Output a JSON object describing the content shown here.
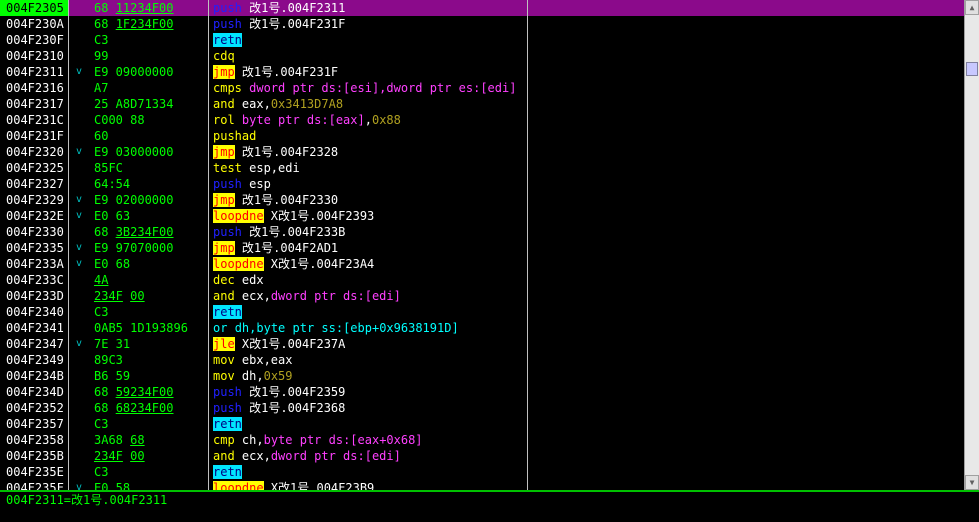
{
  "rows": [
    {
      "addr": "004F2305",
      "arrow": "",
      "hex": [
        {
          "t": "68 ",
          "u": false
        },
        {
          "t": "11234F00",
          "u": true
        }
      ],
      "dis": [
        {
          "t": "push",
          "c": "m-push"
        },
        {
          "t": " 改1号.004F2311",
          "c": "t-white"
        }
      ],
      "sel": true
    },
    {
      "addr": "004F230A",
      "arrow": "",
      "hex": [
        {
          "t": "68 ",
          "u": false
        },
        {
          "t": "1F234F00",
          "u": true
        }
      ],
      "dis": [
        {
          "t": "push",
          "c": "m-push"
        },
        {
          "t": " 改1号.004F231F",
          "c": "t-white"
        }
      ]
    },
    {
      "addr": "004F230F",
      "arrow": "",
      "hex": [
        {
          "t": "C3",
          "u": false
        }
      ],
      "dis": [
        {
          "t": "retn",
          "c": "m-retn"
        }
      ]
    },
    {
      "addr": "004F2310",
      "arrow": "",
      "hex": [
        {
          "t": "99",
          "u": false
        }
      ],
      "dis": [
        {
          "t": "cdq",
          "c": "m-yellow"
        }
      ]
    },
    {
      "addr": "004F2311",
      "arrow": "v",
      "hex": [
        {
          "t": "E9 09000000",
          "u": false
        }
      ],
      "dis": [
        {
          "t": "jmp",
          "c": "m-jmp"
        },
        {
          "t": " 改1号.004F231F",
          "c": "t-white"
        }
      ]
    },
    {
      "addr": "004F2316",
      "arrow": "",
      "hex": [
        {
          "t": "A7",
          "u": false
        }
      ],
      "dis": [
        {
          "t": "cmps ",
          "c": "m-yellow"
        },
        {
          "t": "dword ptr ds:[esi],dword ptr es:[edi]",
          "c": "t-purple"
        }
      ]
    },
    {
      "addr": "004F2317",
      "arrow": "",
      "hex": [
        {
          "t": "25 A8D71334",
          "u": false
        }
      ],
      "dis": [
        {
          "t": "and ",
          "c": "m-yellow"
        },
        {
          "t": "eax,",
          "c": "t-white"
        },
        {
          "t": "0x3413D7A8",
          "c": "t-olive"
        }
      ]
    },
    {
      "addr": "004F231C",
      "arrow": "",
      "hex": [
        {
          "t": "C000 88",
          "u": false
        }
      ],
      "dis": [
        {
          "t": "rol ",
          "c": "m-yellow"
        },
        {
          "t": "byte ptr ds:[eax]",
          "c": "t-purple"
        },
        {
          "t": ",",
          "c": "t-white"
        },
        {
          "t": "0x88",
          "c": "t-olive"
        }
      ]
    },
    {
      "addr": "004F231F",
      "arrow": "",
      "hex": [
        {
          "t": "60",
          "u": false
        }
      ],
      "dis": [
        {
          "t": "pushad",
          "c": "m-yellow"
        }
      ]
    },
    {
      "addr": "004F2320",
      "arrow": "v",
      "hex": [
        {
          "t": "E9 03000000",
          "u": false
        }
      ],
      "dis": [
        {
          "t": "jmp",
          "c": "m-jmp"
        },
        {
          "t": " 改1号.004F2328",
          "c": "t-white"
        }
      ]
    },
    {
      "addr": "004F2325",
      "arrow": "",
      "hex": [
        {
          "t": "85FC",
          "u": false
        }
      ],
      "dis": [
        {
          "t": "test ",
          "c": "m-yellow"
        },
        {
          "t": "esp,edi",
          "c": "t-white"
        }
      ]
    },
    {
      "addr": "004F2327",
      "arrow": "",
      "hex": [
        {
          "t": "64:54",
          "u": false
        }
      ],
      "dis": [
        {
          "t": "push",
          "c": "m-push"
        },
        {
          "t": " esp",
          "c": "t-white"
        }
      ]
    },
    {
      "addr": "004F2329",
      "arrow": "v",
      "hex": [
        {
          "t": "E9 02000000",
          "u": false
        }
      ],
      "dis": [
        {
          "t": "jmp",
          "c": "m-jmp"
        },
        {
          "t": " 改1号.004F2330",
          "c": "t-white"
        }
      ]
    },
    {
      "addr": "004F232E",
      "arrow": "v",
      "hex": [
        {
          "t": "E0 63",
          "u": false
        }
      ],
      "dis": [
        {
          "t": "loopdne",
          "c": "m-loop"
        },
        {
          "t": " X改1号.004F2393",
          "c": "t-white"
        }
      ]
    },
    {
      "addr": "004F2330",
      "arrow": "",
      "hex": [
        {
          "t": "68 ",
          "u": false
        },
        {
          "t": "3B234F00",
          "u": true
        }
      ],
      "dis": [
        {
          "t": "push",
          "c": "m-push"
        },
        {
          "t": " 改1号.004F233B",
          "c": "t-white"
        }
      ]
    },
    {
      "addr": "004F2335",
      "arrow": "v",
      "hex": [
        {
          "t": "E9 97070000",
          "u": false
        }
      ],
      "dis": [
        {
          "t": "jmp",
          "c": "m-jmp"
        },
        {
          "t": " 改1号.004F2AD1",
          "c": "t-white"
        }
      ]
    },
    {
      "addr": "004F233A",
      "arrow": "v",
      "hex": [
        {
          "t": "E0 68",
          "u": false
        }
      ],
      "dis": [
        {
          "t": "loopdne",
          "c": "m-loop"
        },
        {
          "t": " X改1号.004F23A4",
          "c": "t-white"
        }
      ]
    },
    {
      "addr": "004F233C",
      "arrow": "",
      "hex": [
        {
          "t": "4A",
          "u": true
        }
      ],
      "dis": [
        {
          "t": "dec ",
          "c": "m-yellow"
        },
        {
          "t": "edx",
          "c": "t-white"
        }
      ]
    },
    {
      "addr": "004F233D",
      "arrow": "",
      "hex": [
        {
          "t": "234F",
          "u": true
        },
        {
          "t": " ",
          "u": false
        },
        {
          "t": "00",
          "u": true
        }
      ],
      "dis": [
        {
          "t": "and ",
          "c": "m-yellow"
        },
        {
          "t": "ecx,",
          "c": "t-white"
        },
        {
          "t": "dword ptr ds:[edi]",
          "c": "t-purple"
        }
      ]
    },
    {
      "addr": "004F2340",
      "arrow": "",
      "hex": [
        {
          "t": "C3",
          "u": false
        }
      ],
      "dis": [
        {
          "t": "retn",
          "c": "m-retn"
        }
      ]
    },
    {
      "addr": "004F2341",
      "arrow": "",
      "hex": [
        {
          "t": "0AB5 1D193896",
          "u": false
        }
      ],
      "dis": [
        {
          "t": "or ",
          "c": "t-cyan"
        },
        {
          "t": "dh,",
          "c": "t-cyan"
        },
        {
          "t": "byte ptr ss:[ebp+0x9638191D]",
          "c": "t-cyan"
        }
      ]
    },
    {
      "addr": "004F2347",
      "arrow": "v",
      "hex": [
        {
          "t": "7E 31",
          "u": false
        }
      ],
      "dis": [
        {
          "t": "jle",
          "c": "m-jmp"
        },
        {
          "t": " X改1号.004F237A",
          "c": "t-white"
        }
      ]
    },
    {
      "addr": "004F2349",
      "arrow": "",
      "hex": [
        {
          "t": "89C3",
          "u": false
        }
      ],
      "dis": [
        {
          "t": "mov ",
          "c": "m-yellow"
        },
        {
          "t": "ebx,eax",
          "c": "t-white"
        }
      ]
    },
    {
      "addr": "004F234B",
      "arrow": "",
      "hex": [
        {
          "t": "B6 59",
          "u": false
        }
      ],
      "dis": [
        {
          "t": "mov ",
          "c": "m-yellow"
        },
        {
          "t": "dh,",
          "c": "t-white"
        },
        {
          "t": "0x59",
          "c": "t-olive"
        }
      ]
    },
    {
      "addr": "004F234D",
      "arrow": "",
      "hex": [
        {
          "t": "68 ",
          "u": false
        },
        {
          "t": "59234F00",
          "u": true
        }
      ],
      "dis": [
        {
          "t": "push",
          "c": "m-push"
        },
        {
          "t": " 改1号.004F2359",
          "c": "t-white"
        }
      ]
    },
    {
      "addr": "004F2352",
      "arrow": "",
      "hex": [
        {
          "t": "68 ",
          "u": false
        },
        {
          "t": "68234F00",
          "u": true
        }
      ],
      "dis": [
        {
          "t": "push",
          "c": "m-push"
        },
        {
          "t": " 改1号.004F2368",
          "c": "t-white"
        }
      ]
    },
    {
      "addr": "004F2357",
      "arrow": "",
      "hex": [
        {
          "t": "C3",
          "u": false
        }
      ],
      "dis": [
        {
          "t": "retn",
          "c": "m-retn"
        }
      ]
    },
    {
      "addr": "004F2358",
      "arrow": "",
      "hex": [
        {
          "t": "3A68 ",
          "u": false
        },
        {
          "t": "68",
          "u": true
        }
      ],
      "dis": [
        {
          "t": "cmp ",
          "c": "m-yellow"
        },
        {
          "t": "ch,",
          "c": "t-white"
        },
        {
          "t": "byte ptr ds:[eax+0x68]",
          "c": "t-purple"
        }
      ]
    },
    {
      "addr": "004F235B",
      "arrow": "",
      "hex": [
        {
          "t": "234F",
          "u": true
        },
        {
          "t": " ",
          "u": false
        },
        {
          "t": "00",
          "u": true
        }
      ],
      "dis": [
        {
          "t": "and ",
          "c": "m-yellow"
        },
        {
          "t": "ecx,",
          "c": "t-white"
        },
        {
          "t": "dword ptr ds:[edi]",
          "c": "t-purple"
        }
      ]
    },
    {
      "addr": "004F235E",
      "arrow": "",
      "hex": [
        {
          "t": "C3",
          "u": false
        }
      ],
      "dis": [
        {
          "t": "retn",
          "c": "m-retn"
        }
      ]
    },
    {
      "addr": "004F235F",
      "arrow": "v",
      "hex": [
        {
          "t": "E0 58",
          "u": false
        }
      ],
      "dis": [
        {
          "t": "loopdne",
          "c": "m-loop"
        },
        {
          "t": " X改1号.004F23B9",
          "c": "t-white"
        }
      ]
    }
  ],
  "info_line": "004F2311=改1号.004F2311",
  "scrollbar": {
    "up_arrow": "▲",
    "down_arrow": "▼"
  }
}
